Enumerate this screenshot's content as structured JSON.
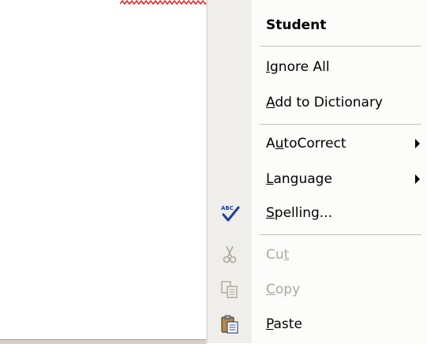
{
  "menu": {
    "items": [
      {
        "label": "Student",
        "accel_index": -1,
        "bold": true,
        "enabled": true,
        "submenu": false,
        "icon": ""
      },
      {
        "label": "Ignore All",
        "accel_index": 0,
        "bold": false,
        "enabled": true,
        "submenu": false,
        "icon": ""
      },
      {
        "label": "Add to Dictionary",
        "accel_index": 0,
        "bold": false,
        "enabled": true,
        "submenu": false,
        "icon": ""
      },
      {
        "label": "AutoCorrect",
        "accel_index": 1,
        "bold": false,
        "enabled": true,
        "submenu": true,
        "icon": ""
      },
      {
        "label": "Language",
        "accel_index": 0,
        "bold": false,
        "enabled": true,
        "submenu": true,
        "icon": ""
      },
      {
        "label": "Spelling...",
        "accel_index": 0,
        "bold": false,
        "enabled": true,
        "submenu": false,
        "icon": "spelling-check-icon"
      },
      {
        "label": "Cut",
        "accel_index": 2,
        "bold": false,
        "enabled": false,
        "submenu": false,
        "icon": "scissors-icon"
      },
      {
        "label": "Copy",
        "accel_index": 0,
        "bold": false,
        "enabled": false,
        "submenu": false,
        "icon": "copy-icon"
      },
      {
        "label": "Paste",
        "accel_index": 0,
        "bold": false,
        "enabled": true,
        "submenu": false,
        "icon": "clipboard-paste-icon"
      }
    ]
  },
  "colors": {
    "menu_background": "#fcfcfb",
    "icon_strip": "#f0eeea",
    "disabled_text": "#aca899",
    "spell_squiggle": "#ff0000",
    "check_blue": "#1f3fa0"
  }
}
